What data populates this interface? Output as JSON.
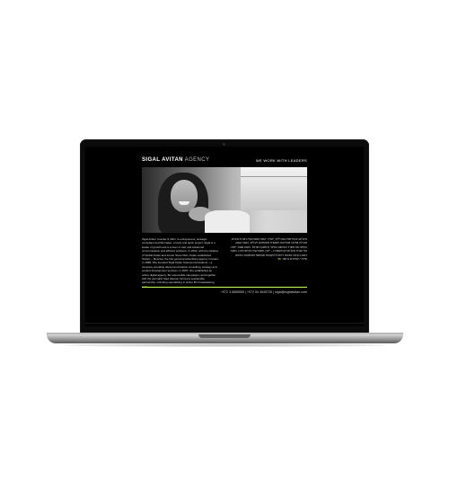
{
  "site": {
    "brand_bold": "SIGAL AVITAN",
    "brand_light": "AGENCY",
    "tagline": "WE WORK WITH LEADERS",
    "hero_image": "portrait-photo",
    "intro_en": "Sigal Avitan, founder & CEO, is entrepreneur, strategic consultant and filmmaker; a lively and quick project. Sigal is a leader of growth and is a doer of vast and advanced communication and efficient solutions. In 2002, with the initiative of Global Avitan and former Sivan Meir, Avitan established TelAviv – Moscow, the first personal advertising agency in Israel. In 1998, She founded Sigal Avitan Telecommunications – a company providing telecommunication consulting, strategy and content development services. In 2007, she established an online digital agency. Be responsible campaigns; and together with the journalist Saul Hanson formed a sustainable partnership, including specializing in online film broadcasting.",
    "intro_he": "סיגל אביטן מייסדת ומנכ\"לית, יזמית, יועצת אסטרטגית ויוצרת סרטים; מובילה צמיחה ופתרונות תקשורת מתקדמים ויעילים. בשנת 2002 הקימה את משרד הפרסום האישי הראשון בישראל. בשנת 1998 ייסדה את חברת סיגל אביטן תקשורת – ייעוץ, אסטרטגיה ופיתוח תוכן. בשנת 2007 הקימה סוכנות דיגיטלית מקוונת ושותפות מתמשכת בתחום שידורי הסרטים ברשת.",
    "more_en": "more",
    "more_he": "עוד",
    "contact": "+972 3 6855555  |  +972 54 4545726  |  sigal@sigalavitan.com"
  },
  "colors": {
    "screen_bg": "#000000",
    "accent": "#c8ff5a",
    "body_text": "#d8d8d8"
  }
}
